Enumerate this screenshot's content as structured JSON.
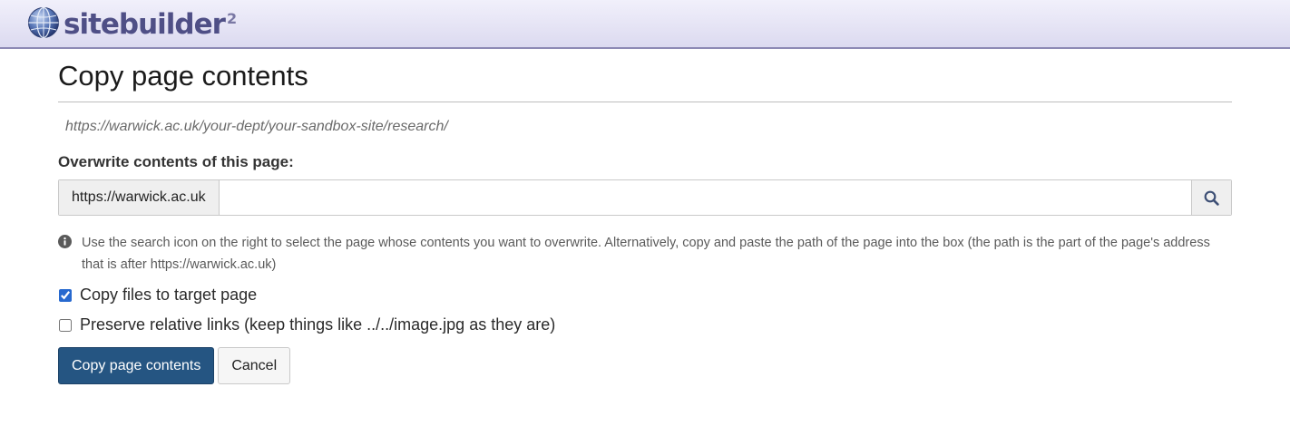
{
  "header": {
    "logo_text": "sitebuilder",
    "logo_superscript": "2"
  },
  "main": {
    "title": "Copy page contents",
    "page_url": "https://warwick.ac.uk/your-dept/your-sandbox-site/research/",
    "field_label": "Overwrite contents of this page:",
    "input_prefix": "https://warwick.ac.uk",
    "input_value": "",
    "help_text": "Use the search icon on the right to select the page whose contents you want to overwrite. Alternatively, copy and paste the path of the page into the box (the path is the part of the page's address that is after https://warwick.ac.uk)",
    "options": [
      {
        "label": "Copy files to target page",
        "checked": true
      },
      {
        "label": "Preserve relative links (keep things like ../../image.jpg as they are)",
        "checked": false
      }
    ],
    "buttons": {
      "submit": "Copy page contents",
      "cancel": "Cancel"
    }
  },
  "icons": {
    "logo": "globe-icon",
    "search": "search-icon",
    "help": "info-circle-icon"
  },
  "colors": {
    "primary_button": "#255582",
    "checkbox_accent": "#2769cf",
    "brand_text": "#4f4f86"
  }
}
